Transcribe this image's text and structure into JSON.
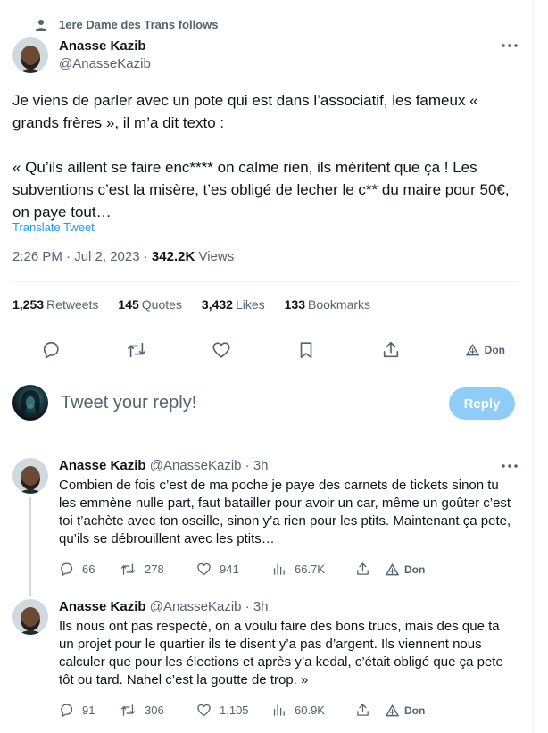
{
  "social_context": {
    "text": "1ere Dame des Trans follows",
    "icon": "person-icon"
  },
  "tweet": {
    "author_name": "Anasse Kazib",
    "author_handle": "@AnasseKazib",
    "text": "Je viens de parler avec un pote qui est dans l’associatif, les fameux « grands frères », il m’a dit texto :\n\n« Qu’ils aillent se faire enc**** on calme rien, ils méritent que ça ! Les subventions c’est la misère, t’es obligé de lecher le c** du maire pour 50€, on paye tout…",
    "translate_label": "Translate Tweet",
    "time": "2:26 PM · Jul 2, 2023 · ",
    "views_count": "342.2K",
    "views_label": " Views"
  },
  "stats": {
    "retweets_count": "1,253",
    "retweets_label": "Retweets",
    "quotes_count": "145",
    "quotes_label": "Quotes",
    "likes_count": "3,432",
    "likes_label": "Likes",
    "bookmarks_count": "133",
    "bookmarks_label": "Bookmarks"
  },
  "actions": {
    "don_label": "Don"
  },
  "reply_box": {
    "placeholder": "Tweet your reply!",
    "button_label": "Reply"
  },
  "replies": [
    {
      "author_name": "Anasse Kazib",
      "author_handle": "@AnasseKazib · 3h",
      "text": "Combien de fois c’est de ma poche je paye des carnets de tickets sinon tu les emmène nulle part, faut batailler pour avoir un car, même un goûter c’est toi t’achète avec ton oseille, sinon y’a rien pour les ptits. Maintenant ça pete, qu’ils se débrouillent avec les ptits…",
      "replies": "66",
      "retweets": "278",
      "likes": "941",
      "views": "66.7K",
      "don": "Don"
    },
    {
      "author_name": "Anasse Kazib",
      "author_handle": "@AnasseKazib · 3h",
      "text": "Ils nous ont pas respecté, on a voulu faire des bons trucs, mais des que ta un projet pour le quartier ils te disent y’a pas d’argent. Ils viennent nous calculer que pour les élections et après y’a kedal, c’était obligé que ça pete tôt ou tard. Nahel c’est la goutte de trop. »",
      "replies": "91",
      "retweets": "306",
      "likes": "1,105",
      "views": "60.9K",
      "don": "Don"
    }
  ],
  "colors": {
    "accent": "#1d9bf0",
    "reply_button": "#8ecdf8",
    "text": "#0f1419",
    "secondary": "#536471"
  }
}
